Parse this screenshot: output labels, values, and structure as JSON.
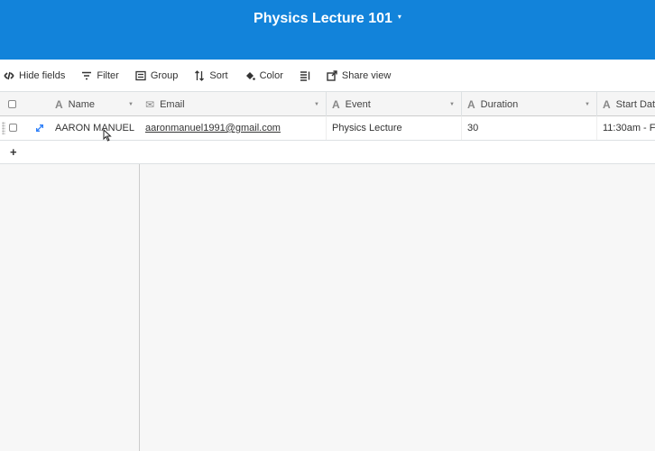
{
  "header": {
    "title": "Physics Lecture 101",
    "caret": "▾"
  },
  "toolbar": {
    "hide_fields": "Hide fields",
    "filter": "Filter",
    "group": "Group",
    "sort": "Sort",
    "color": "Color",
    "share_view": "Share view"
  },
  "columns": {
    "name": "Name",
    "email": "Email",
    "event": "Event",
    "duration": "Duration",
    "start_date": "Start Dat"
  },
  "row": {
    "name": "AARON MANUEL",
    "email": "aaronmanuel1991@gmail.com",
    "event": "Physics Lecture",
    "duration": "30",
    "start_date": "11:30am - Fr"
  },
  "add_row_label": "+",
  "colors": {
    "header_bg": "#1283da",
    "expand_icon": "#2d7ff9"
  }
}
